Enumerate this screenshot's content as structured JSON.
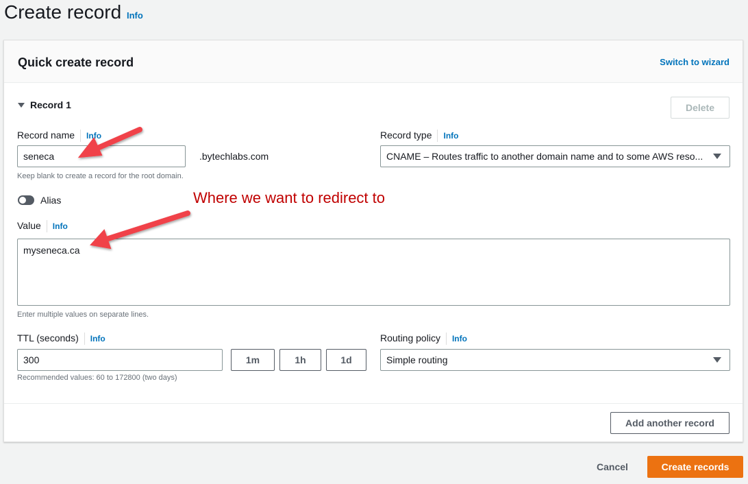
{
  "page": {
    "title": "Create record",
    "info": "Info"
  },
  "panel": {
    "title": "Quick create record",
    "switch_label": "Switch to wizard"
  },
  "record": {
    "section_label": "Record 1",
    "delete_label": "Delete",
    "name": {
      "label": "Record name",
      "info": "Info",
      "value": "seneca",
      "suffix": ".bytechlabs.com",
      "hint": "Keep blank to create a record for the root domain."
    },
    "type": {
      "label": "Record type",
      "info": "Info",
      "value": "CNAME – Routes traffic to another domain name and to some AWS reso..."
    },
    "alias": {
      "label": "Alias",
      "enabled": false
    },
    "value": {
      "label": "Value",
      "info": "Info",
      "value": "myseneca.ca",
      "hint": "Enter multiple values on separate lines."
    },
    "ttl": {
      "label": "TTL (seconds)",
      "info": "Info",
      "value": "300",
      "presets": [
        "1m",
        "1h",
        "1d"
      ],
      "hint": "Recommended values: 60 to 172800 (two days)"
    },
    "routing": {
      "label": "Routing policy",
      "info": "Info",
      "value": "Simple routing"
    }
  },
  "add_label": "Add another record",
  "footer": {
    "cancel": "Cancel",
    "create": "Create records"
  },
  "annotation": {
    "text": "Where we want to redirect to",
    "color": "#c00000",
    "arrow_color": "#f0434a"
  },
  "colors": {
    "accent": "#ec7211",
    "link": "#0073bb"
  }
}
